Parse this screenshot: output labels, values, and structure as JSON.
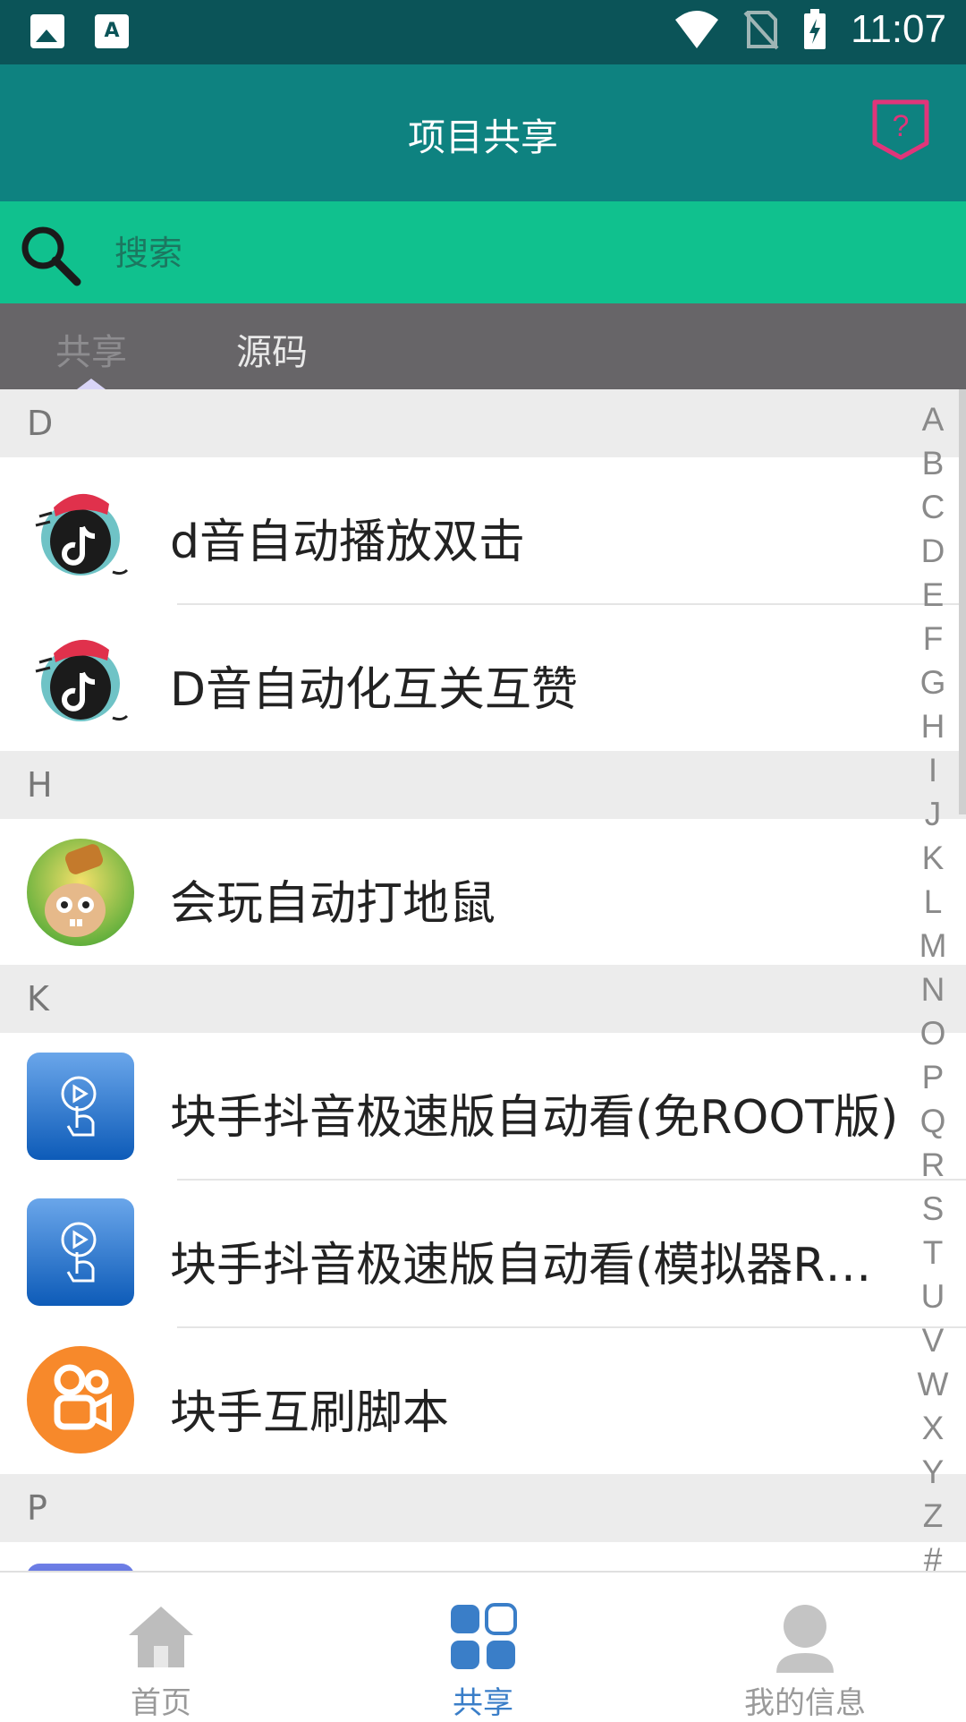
{
  "status_bar": {
    "time": "11:07"
  },
  "header": {
    "title": "项目共享"
  },
  "search": {
    "placeholder": "搜索"
  },
  "tabs": [
    {
      "label": "共享"
    },
    {
      "label": "源码"
    }
  ],
  "sections": [
    {
      "letter": "D",
      "items": [
        {
          "label": "d音自动播放双击"
        },
        {
          "label": "D音自动化互关互赞"
        }
      ]
    },
    {
      "letter": "H",
      "items": [
        {
          "label": "会玩自动打地鼠"
        }
      ]
    },
    {
      "letter": "K",
      "items": [
        {
          "label": "块手抖音极速版自动看(免ROOT版)"
        },
        {
          "label": "块手抖音极速版自动看(模拟器RO…"
        },
        {
          "label": "块手互刷脚本"
        }
      ]
    },
    {
      "letter": "P",
      "items": []
    }
  ],
  "alphabet": [
    "A",
    "B",
    "C",
    "D",
    "E",
    "F",
    "G",
    "H",
    "I",
    "J",
    "K",
    "L",
    "M",
    "N",
    "O",
    "P",
    "Q",
    "R",
    "S",
    "T",
    "U",
    "V",
    "W",
    "X",
    "Y",
    "Z",
    "#"
  ],
  "bottom_nav": [
    {
      "label": "首页"
    },
    {
      "label": "共享"
    },
    {
      "label": "我的信息"
    }
  ],
  "colors": {
    "status_bar": "#0b5458",
    "app_bar": "#0e8280",
    "search_bar": "#10c18e",
    "tab_bar": "#676568",
    "nav_active": "#3a7ec8",
    "help_icon": "#e0357a"
  }
}
